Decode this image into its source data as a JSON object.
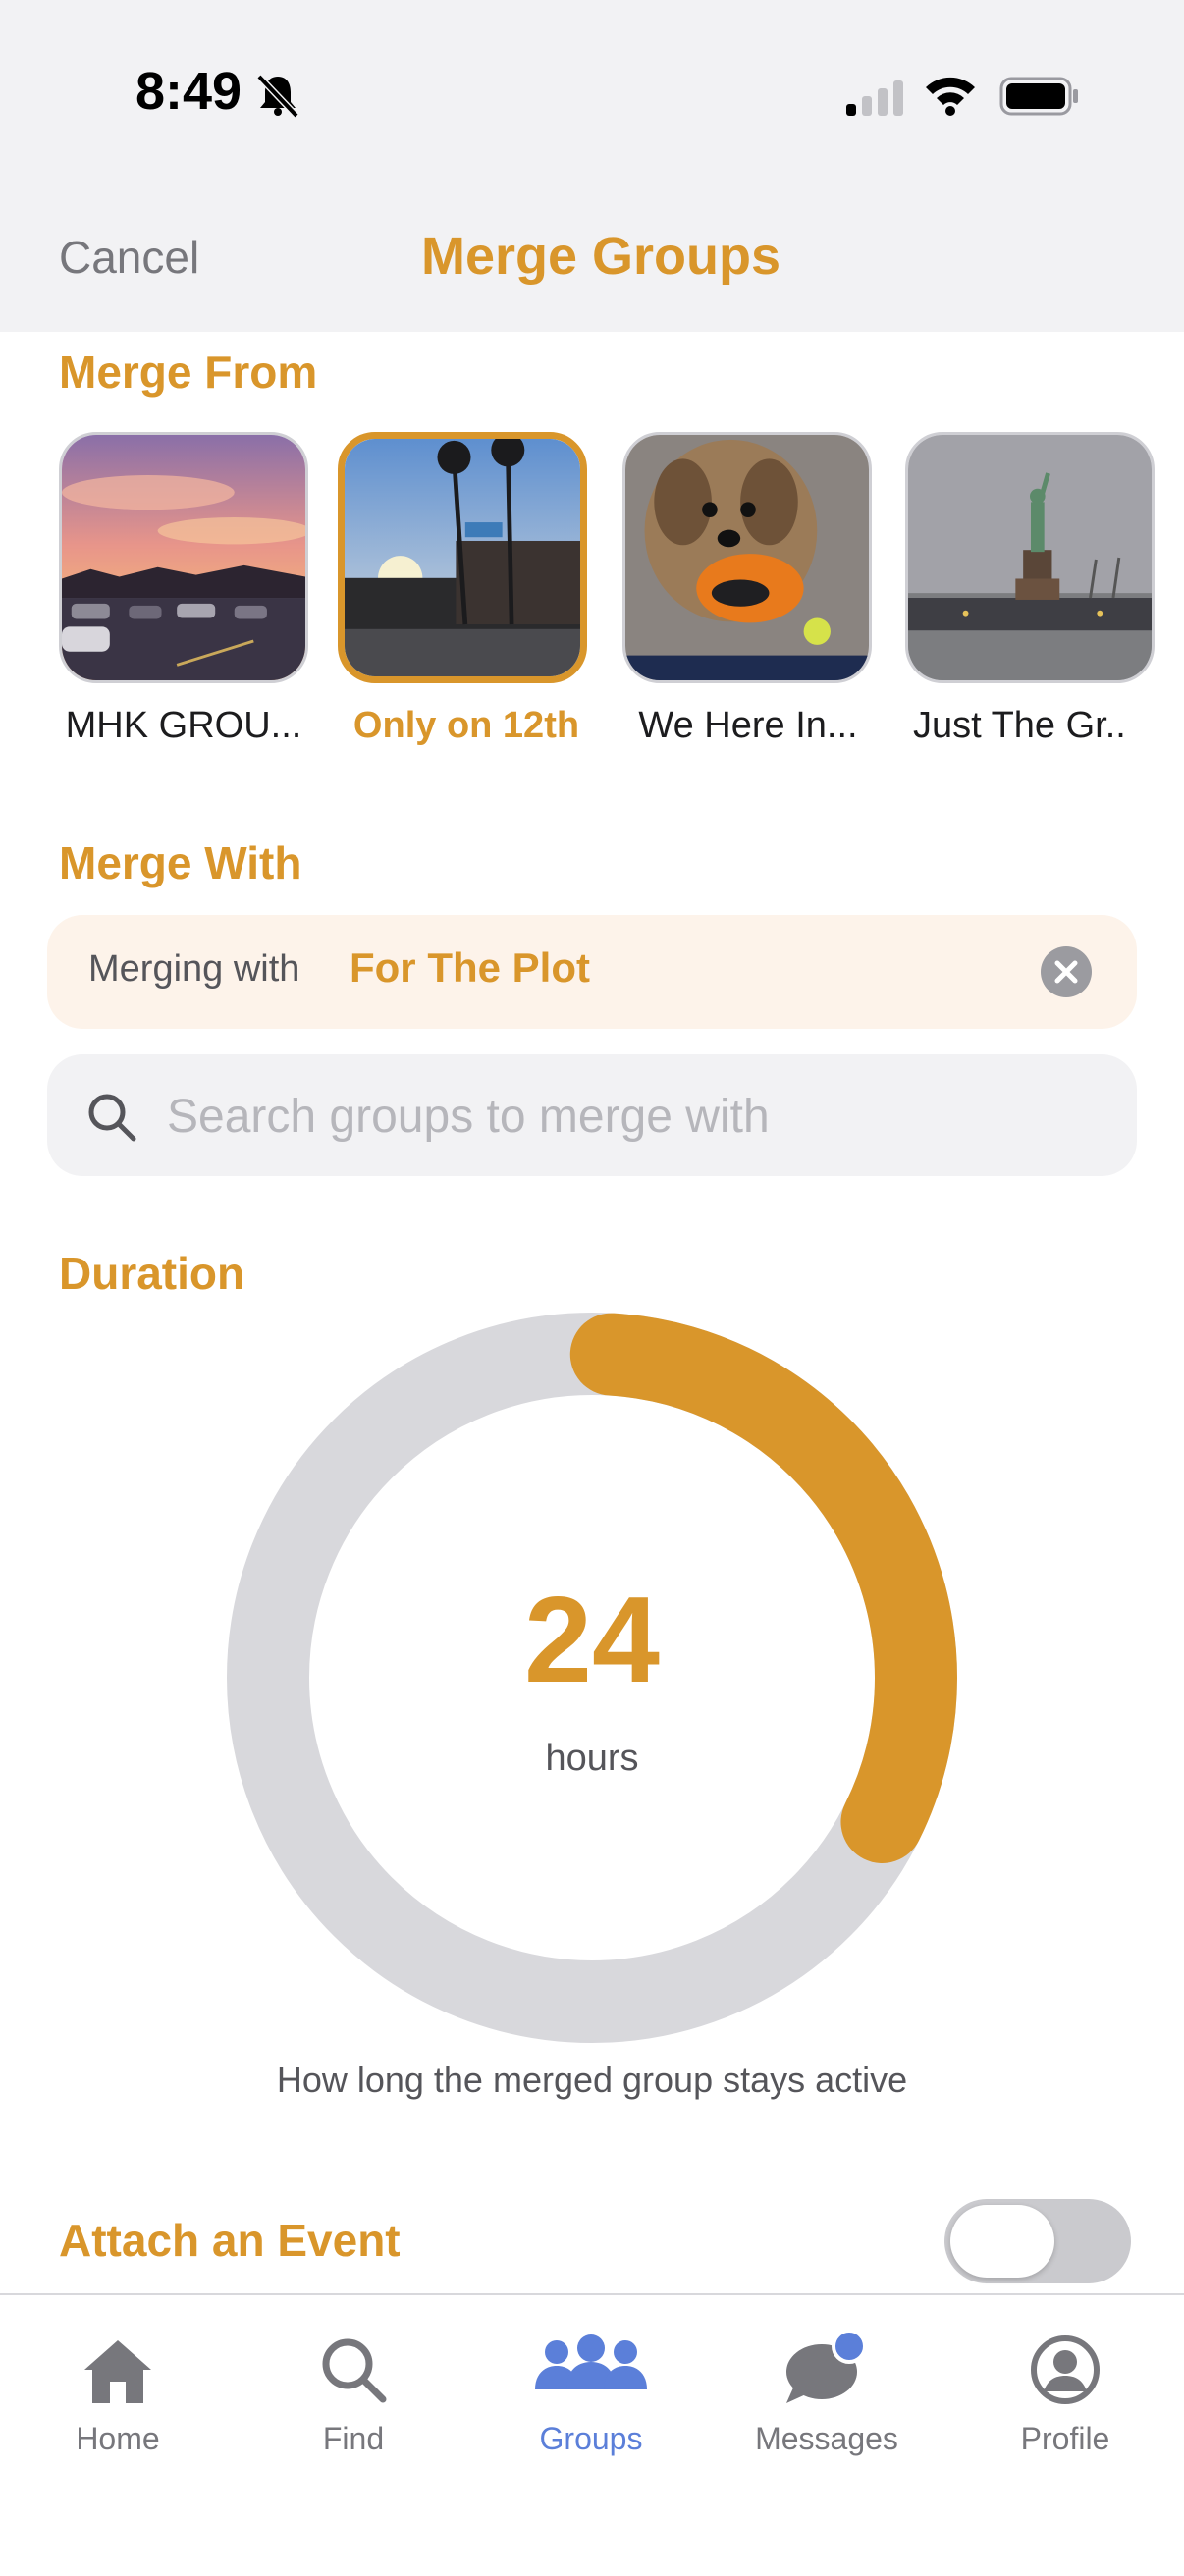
{
  "status_bar": {
    "time": "8:49"
  },
  "nav": {
    "cancel_label": "Cancel",
    "title": "Merge Groups"
  },
  "merge_from": {
    "title": "Merge From",
    "groups": [
      {
        "label": "MHK GROU...",
        "selected": false
      },
      {
        "label": "Only on 12th",
        "selected": true
      },
      {
        "label": "We Here In...",
        "selected": false
      },
      {
        "label": "Just The Gr..",
        "selected": false
      }
    ]
  },
  "merge_with": {
    "title": "Merge With",
    "prefix": "Merging with",
    "target": "For The Plot",
    "search_placeholder": "Search groups to merge with"
  },
  "duration": {
    "title": "Duration",
    "value": "24",
    "unit": "hours",
    "fraction": 0.333,
    "caption": "How long the merged group stays active"
  },
  "attach_event": {
    "title": "Attach an Event",
    "enabled": false
  },
  "tabs": [
    {
      "label": "Home",
      "active": false
    },
    {
      "label": "Find",
      "active": false
    },
    {
      "label": "Groups",
      "active": true
    },
    {
      "label": "Messages",
      "active": false
    },
    {
      "label": "Profile",
      "active": false
    }
  ],
  "colors": {
    "accent": "#d9962b",
    "tab_active": "#5b7fd9",
    "track": "#d8d8dc"
  }
}
